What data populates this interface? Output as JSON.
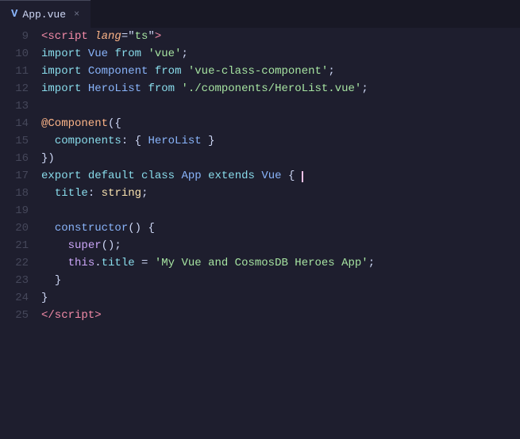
{
  "tab": {
    "icon": "V",
    "filename": "App.vue",
    "close_label": "×"
  },
  "lines": [
    {
      "num": "9",
      "content": "script_open"
    },
    {
      "num": "10",
      "content": "import_vue"
    },
    {
      "num": "11",
      "content": "import_component"
    },
    {
      "num": "12",
      "content": "import_herolist"
    },
    {
      "num": "13",
      "content": "empty"
    },
    {
      "num": "14",
      "content": "decorator"
    },
    {
      "num": "15",
      "content": "components"
    },
    {
      "num": "16",
      "content": "close_brace"
    },
    {
      "num": "17",
      "content": "export_class"
    },
    {
      "num": "18",
      "content": "title_prop"
    },
    {
      "num": "19",
      "content": "empty"
    },
    {
      "num": "20",
      "content": "constructor"
    },
    {
      "num": "21",
      "content": "super"
    },
    {
      "num": "22",
      "content": "this_title"
    },
    {
      "num": "23",
      "content": "close_inner"
    },
    {
      "num": "24",
      "content": "close_class"
    },
    {
      "num": "25",
      "content": "script_close"
    }
  ]
}
